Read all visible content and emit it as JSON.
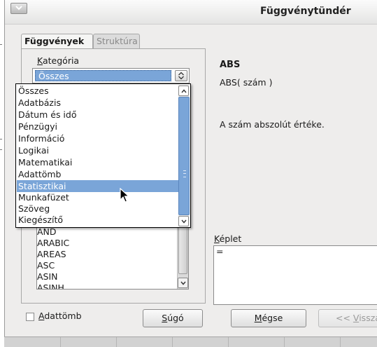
{
  "window": {
    "title": "Függvénytündér"
  },
  "tabs": [
    {
      "label": "Függvények",
      "active": true
    },
    {
      "label": "Struktúra",
      "active": false
    }
  ],
  "category": {
    "label": "Kategória",
    "label_underline": "K",
    "label_rest": "ategória",
    "selected": "Összes",
    "options": [
      "Összes",
      "Adatbázis",
      "Dátum és idő",
      "Pénzügyi",
      "Információ",
      "Logikai",
      "Matematikai",
      "Adattömb",
      "Statisztikai",
      "Munkafüzet",
      "Szöveg",
      "Kiegészítő"
    ],
    "highlighted": "Statisztikai"
  },
  "function_list": {
    "items": [
      "AND",
      "ARABIC",
      "AREAS",
      "ASC",
      "ASIN",
      "ASINH"
    ]
  },
  "function_info": {
    "name": "ABS",
    "syntax": "ABS( szám )",
    "description": "A szám abszolút értéke."
  },
  "formula": {
    "label": "Képlet",
    "label_underline": "K",
    "label_rest": "éplet",
    "value": "="
  },
  "array_checkbox": {
    "label": "Adattömb",
    "label_underline": "A",
    "label_rest": "dattömb",
    "checked": false
  },
  "buttons": {
    "help_underline": "S",
    "help_rest": "úgó",
    "cancel_underline": "M",
    "cancel_rest": "égse",
    "back_prefix": "<< ",
    "back_underline": "V",
    "back_rest": "issza"
  },
  "colors": {
    "selection": "#7aa5d8",
    "dialog_bg": "#eeedec"
  },
  "icons": {
    "window_menu": "chevron-down-icon",
    "combo": "updown-arrows-icon",
    "cursor": "mouse-pointer-icon"
  }
}
